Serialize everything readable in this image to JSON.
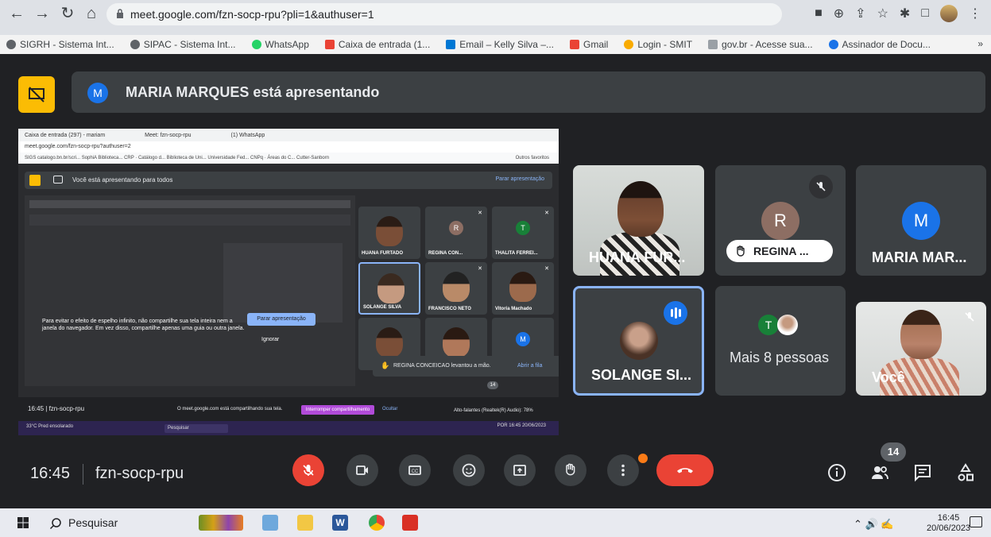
{
  "browser": {
    "url": "meet.google.com/fzn-socp-rpu?pli=1&authuser=1",
    "bookmarks": [
      "SIGRH - Sistema Int...",
      "SIPAC - Sistema Int...",
      "WhatsApp",
      "Caixa de entrada (1...",
      "Email – Kelly Silva –...",
      "Gmail",
      "Login - SMIT",
      "gov.br - Acesse sua...",
      "Assinador de Docu..."
    ],
    "more": "»"
  },
  "meet": {
    "presenter_initial": "M",
    "presenting_text": "MARIA MARQUES está apresentando",
    "clock": "16:45",
    "meeting_code": "fzn-socp-rpu",
    "people_count": "14",
    "tiles": {
      "huana": "HUANA FUR...",
      "regina_initial": "R",
      "regina": "REGINA ...",
      "maria_initial": "M",
      "maria": "MARIA MAR...",
      "solange": "SOLANGE SI...",
      "more_initial": "T",
      "more": "Mais 8 pessoas",
      "you": "Você"
    },
    "colors": {
      "presenter": "#1a73e8",
      "regina": "#8d6e63",
      "maria": "#1a73e8",
      "thalita": "#188038",
      "end_call": "#ea4335"
    }
  },
  "shared": {
    "tabs": [
      "Caixa de entrada (297) - mariam",
      "Meet: fzn-socp-rpu",
      "(1) WhatsApp"
    ],
    "address": "meet.google.com/fzn-socp-rpu?authuser=2",
    "bookmarks_line": "SIGS   catalogo.bn.br/scri...   SophiA Biblioteca...   CRP · Catálogo d...   Biblioteca de Uni...   Universidade Fed...   CNPq · Áreas do C...   Cutter-Sanborn",
    "other_favs": "Outros favoritos",
    "presenting_all": "Você está apresentando para todos",
    "stop": "Parar apresentação",
    "tip": "Para evitar o efeito de espelho infinito, não compartilhe sua tela inteira nem a janela do navegador. Em vez disso, compartilhe apenas uma guia ou outra janela.",
    "tip_button": "Parar apresentação",
    "ignore": "Ignorar",
    "tiles": {
      "huana": "HUANA FURTADO",
      "regina_initial": "R",
      "regina": "REGINA CON...",
      "thalita_initial": "T",
      "thalita": "THALITA FERREI...",
      "solange": "SOLANGE SILVA",
      "francisco": "FRANCISCO NETO",
      "vitoria": "Vitoria Machado",
      "m_initial": "M"
    },
    "raise_text": "REGINA CONCEICAO levantou a mão.",
    "raise_open": "Abrir a fila",
    "badge": "14",
    "clock": "16:45",
    "code": "fzn-socp-rpu",
    "sharing": "O meet.google.com está compartilhando sua tela.",
    "stop_share": "Interromper compartilhamento",
    "hide": "Ocultar",
    "speakers": "Alto-falantes (Realtek(R) Audio): 78%",
    "weather": "33°C Pred ensolarado",
    "search": "Pesquisar",
    "lang": "POR",
    "time": "16:45",
    "date": "20/06/2023"
  },
  "taskbar": {
    "search": "Pesquisar",
    "time": "16:45",
    "date": "20/06/2023"
  }
}
